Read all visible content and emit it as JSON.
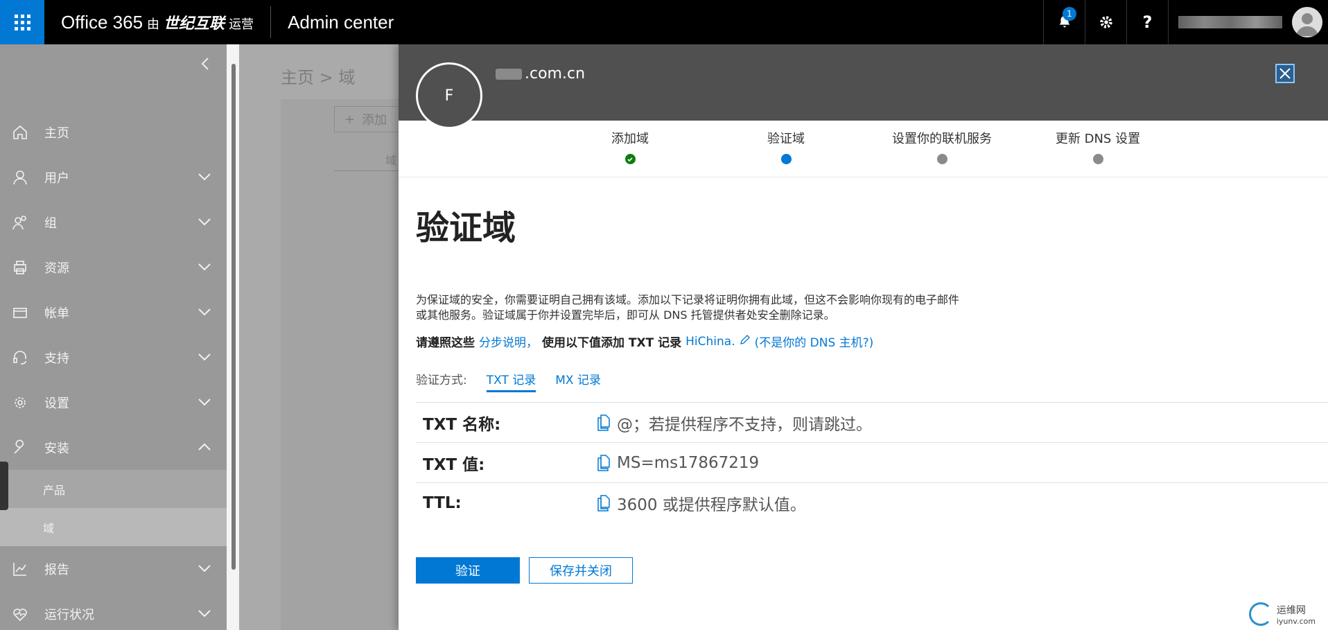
{
  "topbar": {
    "product": "Office 365",
    "by": "由",
    "partner": "世纪互联",
    "operated": "运营",
    "app_title": "Admin center",
    "notification_count": "1",
    "help_label": "?"
  },
  "sidebar": {
    "items": [
      {
        "label": "主页",
        "icon": "home-icon"
      },
      {
        "label": "用户",
        "icon": "user-icon"
      },
      {
        "label": "组",
        "icon": "group-icon"
      },
      {
        "label": "资源",
        "icon": "printer-icon"
      },
      {
        "label": "帐单",
        "icon": "card-icon"
      },
      {
        "label": "支持",
        "icon": "headset-icon"
      },
      {
        "label": "设置",
        "icon": "gear-icon"
      },
      {
        "label": "安装",
        "icon": "wrench-icon"
      }
    ],
    "sub_items": [
      {
        "label": "产品"
      },
      {
        "label": "域"
      }
    ],
    "bottom_items": [
      {
        "label": "报告",
        "icon": "chart-icon"
      },
      {
        "label": "运行状况",
        "icon": "heart-icon"
      }
    ]
  },
  "background": {
    "breadcrumb": "主页 > 域",
    "add_label": "添加",
    "column": "域"
  },
  "panel": {
    "avatar_letter": "F",
    "domain_suffix": ".com.cn",
    "steps": [
      {
        "label": "添加域",
        "state": "done"
      },
      {
        "label": "验证域",
        "state": "current"
      },
      {
        "label": "设置你的联机服务",
        "state": "todo"
      },
      {
        "label": "更新 DNS 设置",
        "state": "todo"
      }
    ],
    "heading": "验证域",
    "description_line1": "为保证域的安全，你需要证明自己拥有该域。添加以下记录将证明你拥有此域，但这不会影响你现有的电子邮件",
    "description_line2": "或其他服务。验证域属于你并设置完毕后，即可从 DNS 托管提供者处安全删除记录。",
    "instr_follow": "请遵照这些",
    "instr_link": "分步说明，",
    "instr_use": "使用以下值添加 TXT 记录",
    "instr_host": "HiChina.",
    "instr_not_host": "(不是你的 DNS 主机?)",
    "method_label": "验证方式:",
    "method_txt": "TXT 记录",
    "method_mx": "MX 记录",
    "records": [
      {
        "label": "TXT 名称:",
        "value": "@；若提供程序不支持，则请跳过。"
      },
      {
        "label": "TXT 值:",
        "value": "MS=ms17867219"
      },
      {
        "label": "TTL:",
        "value": "3600 或提供程序默认值。"
      }
    ],
    "verify_button": "验证",
    "save_close_button": "保存并关闭"
  },
  "watermark": {
    "text1": "运维网",
    "text2": "iyunv.com"
  },
  "colors": {
    "accent": "#0078d4",
    "topbar": "#000000",
    "panel_header": "#505050",
    "done": "#107c10"
  }
}
